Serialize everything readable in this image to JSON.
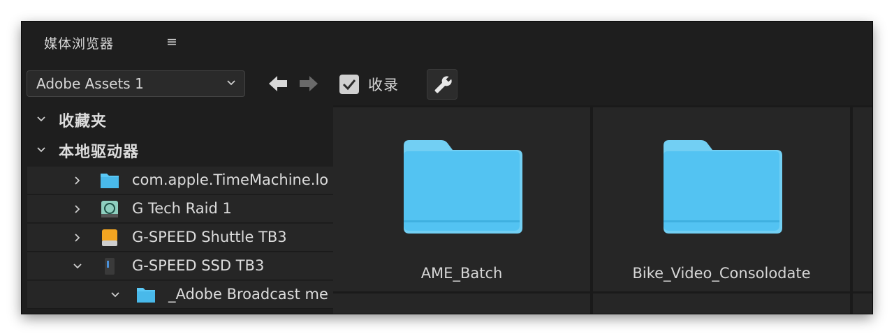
{
  "panel": {
    "title": "媒体浏览器",
    "menu_glyph": "≡"
  },
  "toolbar": {
    "location": "Adobe Assets 1",
    "ingest_label": "收录",
    "ingest_checked": true,
    "icons": [
      "chevron-down-icon",
      "arrow-left-icon",
      "arrow-right-icon",
      "checkbox-icon",
      "wrench-icon"
    ]
  },
  "tree": {
    "favorites_label": "收藏夹",
    "local_drives_label": "本地驱动器",
    "items": [
      {
        "label": "com.apple.TimeMachine.lo",
        "icon": "folder-icon",
        "expanded": false
      },
      {
        "label": "G Tech Raid 1",
        "icon": "time-machine-drive-icon",
        "expanded": false
      },
      {
        "label": "G-SPEED Shuttle TB3",
        "icon": "external-drive-icon",
        "expanded": false
      },
      {
        "label": "G-SPEED SSD TB3",
        "icon": "ssd-drive-icon",
        "expanded": true
      },
      {
        "label": "_Adobe Broadcast me",
        "icon": "folder-icon",
        "expanded": true
      }
    ]
  },
  "grid": {
    "tiles": [
      {
        "label": "AME_Batch",
        "icon": "folder-icon"
      },
      {
        "label": "Bike_Video_Consolodate",
        "icon": "folder-icon"
      }
    ]
  },
  "colors": {
    "panel_bg": "#1e1e1e",
    "folder_blue": "#5ac8f5",
    "text": "#d6d6d6"
  }
}
